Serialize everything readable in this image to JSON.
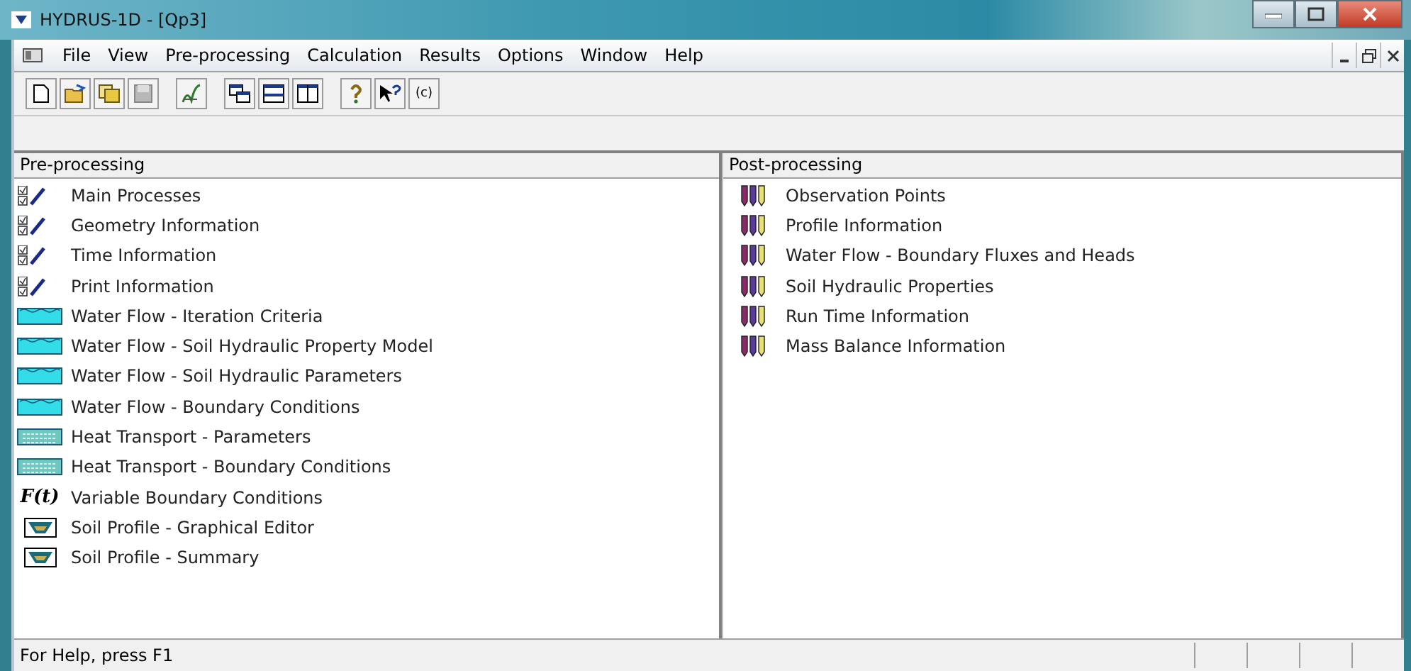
{
  "window": {
    "title": "HYDRUS-1D - [Qp3]"
  },
  "menu": [
    "File",
    "View",
    "Pre-processing",
    "Calculation",
    "Results",
    "Options",
    "Window",
    "Help"
  ],
  "toolbar": {
    "about_label": "(c)"
  },
  "pre_processing": {
    "title": "Pre-processing",
    "items": [
      {
        "kind": "checklist",
        "label": "Main Processes"
      },
      {
        "kind": "checklist",
        "label": "Geometry Information"
      },
      {
        "kind": "checklist",
        "label": "Time Information"
      },
      {
        "kind": "checklist",
        "label": "Print Information"
      },
      {
        "kind": "water",
        "label": "Water Flow - Iteration Criteria"
      },
      {
        "kind": "water",
        "label": "Water Flow - Soil Hydraulic Property Model"
      },
      {
        "kind": "water",
        "label": "Water Flow - Soil Hydraulic Parameters"
      },
      {
        "kind": "water",
        "label": "Water Flow - Boundary Conditions"
      },
      {
        "kind": "heat",
        "label": "Heat Transport - Parameters"
      },
      {
        "kind": "heat",
        "label": "Heat Transport - Boundary Conditions"
      },
      {
        "kind": "function",
        "icon_text": "F(t)",
        "label": "Variable Boundary Conditions"
      },
      {
        "kind": "profile",
        "label": "Soil Profile - Graphical Editor"
      },
      {
        "kind": "profile",
        "label": "Soil Profile - Summary"
      }
    ]
  },
  "post_processing": {
    "title": "Post-processing",
    "items": [
      {
        "label": "Observation Points"
      },
      {
        "label": "Profile Information"
      },
      {
        "label": "Water Flow - Boundary Fluxes and Heads"
      },
      {
        "label": "Soil Hydraulic Properties"
      },
      {
        "label": "Run Time Information"
      },
      {
        "label": "Mass Balance Information"
      }
    ]
  },
  "status_bar": {
    "text": "For Help, press F1"
  }
}
